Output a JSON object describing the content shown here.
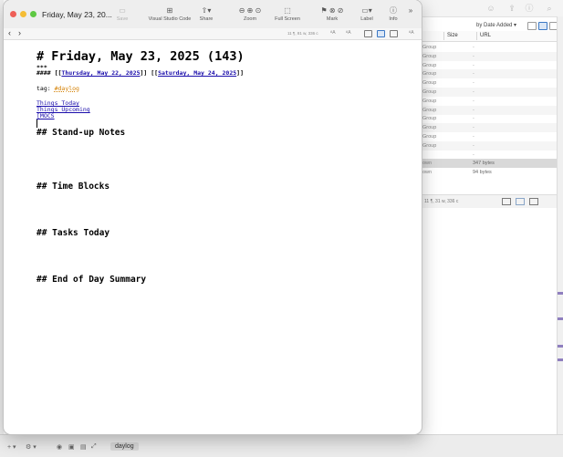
{
  "window": {
    "title": "Friday, May 23, 20...",
    "toolbar": [
      {
        "name": "save",
        "label": "Save",
        "icon": "save-icon"
      },
      {
        "name": "vscode",
        "label": "Visual Studio Code",
        "icon": "vscode-icon"
      },
      {
        "name": "share",
        "label": "Share",
        "icon": "share-icon"
      },
      {
        "name": "zoom",
        "label": "Zoom",
        "icon": "zoom-icon"
      },
      {
        "name": "fullscreen",
        "label": "Full Screen",
        "icon": "fullscreen-icon"
      },
      {
        "name": "mark",
        "label": "Mark",
        "icon": "flag-icon"
      },
      {
        "name": "label",
        "label": "Label",
        "icon": "label-icon"
      },
      {
        "name": "info",
        "label": "Info",
        "icon": "info-icon"
      }
    ],
    "stats": "11 ¶, 81 w, 336 c"
  },
  "document": {
    "heading": "# Friday, May 23, 2025 (143)",
    "rule": "***",
    "nav_prefix": "#### [[",
    "prev_link": "Thursday, May 22, 2025",
    "nav_middle": "]]  [[",
    "next_link": "Saturday, May 24, 2025",
    "nav_suffix": "]]",
    "tag_prefix": "tag: ",
    "tag_value": "#daylog",
    "links": [
      "Things Today",
      "Things Upcoming",
      "[MOCS"
    ],
    "sections": [
      "## Stand-up Notes",
      "## Time Blocks",
      "## Tasks Today",
      "## End of Day Summary"
    ]
  },
  "background_window": {
    "sort": "by Date Added",
    "columns": [
      "Size",
      "URL"
    ],
    "rows": [
      {
        "kind": "Group",
        "value": "-"
      },
      {
        "kind": "Group",
        "value": "-"
      },
      {
        "kind": "Group",
        "value": "-"
      },
      {
        "kind": "Group",
        "value": "-"
      },
      {
        "kind": "Group",
        "value": "-"
      },
      {
        "kind": "Group",
        "value": "-"
      },
      {
        "kind": "Group",
        "value": "-"
      },
      {
        "kind": "Group",
        "value": "-"
      },
      {
        "kind": "Group",
        "value": "-"
      },
      {
        "kind": "Group",
        "value": "-"
      },
      {
        "kind": "Group",
        "value": "-"
      },
      {
        "kind": "Group",
        "value": "-"
      },
      {
        "kind": "",
        "value": "-"
      },
      {
        "kind": "own",
        "value": "347 bytes"
      },
      {
        "kind": "own",
        "value": "94 bytes"
      }
    ],
    "status": "11 ¶, 31 w, 336 c",
    "bottom_tag": "daylog"
  }
}
